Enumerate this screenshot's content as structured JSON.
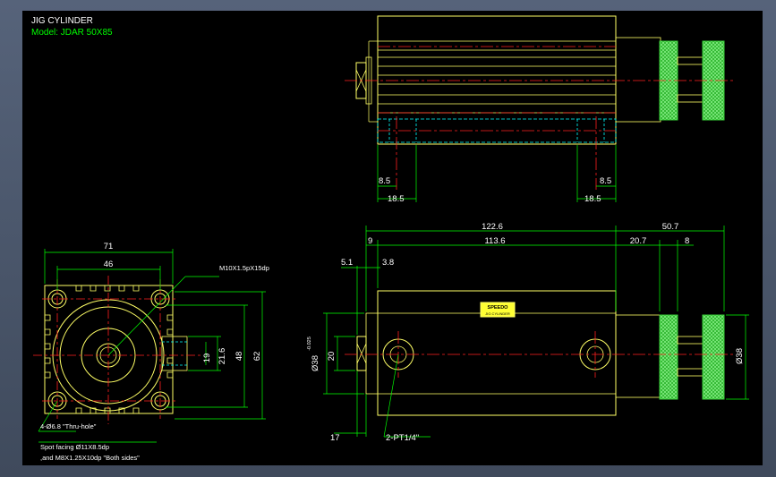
{
  "title": "JIG CYLINDER",
  "model": "Model: JDAR 50X85",
  "colors": {
    "background": "#000000",
    "outline": "#ffff66",
    "dimension": "#00ff00",
    "centerline": "#ff2020",
    "hidden": "#00ffff",
    "knob": "#44dd44",
    "text": "#ffffff",
    "window_frame": "#4f5b6b"
  },
  "top_view": {
    "dims": {
      "d1": "8.5",
      "d2": "18.5",
      "d3": "8.5",
      "d4": "18.5"
    }
  },
  "end_view": {
    "dims": {
      "width": "71",
      "pitch": "46",
      "h1": "21.6",
      "h2": "19",
      "h3": "48",
      "h4": "62"
    },
    "callouts": {
      "tap": "M10X1.5pX15dp",
      "holes": "4-Ø6.8 \"Thru-hole\"",
      "spot1": "Spot facing Ø11X8.5dp",
      "spot2": ",and M8X1.25X10dp \"Both sides\""
    }
  },
  "side_view": {
    "dims": {
      "overall": "122.6",
      "ext": "50.7",
      "rod": "9",
      "body": "113.6",
      "cap": "20.7",
      "knob_w": "8",
      "a": "5.1",
      "b": "3.8",
      "bore": "20",
      "flange": "17",
      "diam_right": "Ø38",
      "diam_left": "Ø38",
      "diam_tol": "-0.025"
    },
    "port_label": "2-PT1/4\"",
    "badge_text": "SPEEDO",
    "badge_sub": "JIG CYLINDER"
  }
}
